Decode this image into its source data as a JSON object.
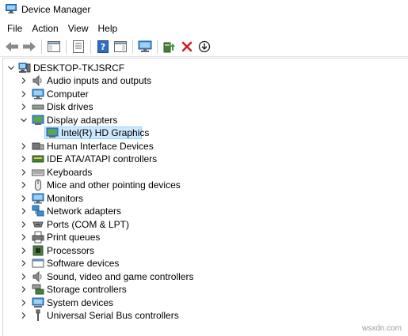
{
  "window": {
    "title": "Device Manager"
  },
  "menu": [
    "File",
    "Action",
    "View",
    "Help"
  ],
  "toolbar": {
    "buttons": [
      "back-arrow",
      "forward-arrow",
      "show-hide-tree",
      "properties",
      "help",
      "action-pane",
      "monitor",
      "update-driver",
      "uninstall",
      "scan-hardware"
    ]
  },
  "tree": {
    "root": "DESKTOP-TKJSRCF",
    "items": [
      {
        "label": "Audio inputs and outputs",
        "icon": "speaker-icon",
        "expanded": false
      },
      {
        "label": "Computer",
        "icon": "computer-icon",
        "expanded": false
      },
      {
        "label": "Disk drives",
        "icon": "disk-drive-icon",
        "expanded": false
      },
      {
        "label": "Display adapters",
        "icon": "display-adapter-icon",
        "expanded": true,
        "children": [
          {
            "label": "Intel(R) HD Graphics",
            "icon": "display-adapter-icon",
            "selected": true
          }
        ]
      },
      {
        "label": "Human Interface Devices",
        "icon": "hid-icon",
        "expanded": false
      },
      {
        "label": "IDE ATA/ATAPI controllers",
        "icon": "ide-controller-icon",
        "expanded": false
      },
      {
        "label": "Keyboards",
        "icon": "keyboard-icon",
        "expanded": false
      },
      {
        "label": "Mice and other pointing devices",
        "icon": "mouse-icon",
        "expanded": false
      },
      {
        "label": "Monitors",
        "icon": "monitor-icon",
        "expanded": false
      },
      {
        "label": "Network adapters",
        "icon": "network-adapter-icon",
        "expanded": false
      },
      {
        "label": "Ports (COM & LPT)",
        "icon": "port-icon",
        "expanded": false
      },
      {
        "label": "Print queues",
        "icon": "printer-icon",
        "expanded": false
      },
      {
        "label": "Processors",
        "icon": "processor-icon",
        "expanded": false
      },
      {
        "label": "Software devices",
        "icon": "software-device-icon",
        "expanded": false
      },
      {
        "label": "Sound, video and game controllers",
        "icon": "sound-icon",
        "expanded": false
      },
      {
        "label": "Storage controllers",
        "icon": "storage-controller-icon",
        "expanded": false
      },
      {
        "label": "System devices",
        "icon": "system-device-icon",
        "expanded": false
      },
      {
        "label": "Universal Serial Bus controllers",
        "icon": "usb-icon",
        "expanded": false
      }
    ]
  },
  "colors": {
    "selection": "#cce8ff",
    "selection_border": "#99d1ff"
  },
  "watermark": "wsxdn.com"
}
